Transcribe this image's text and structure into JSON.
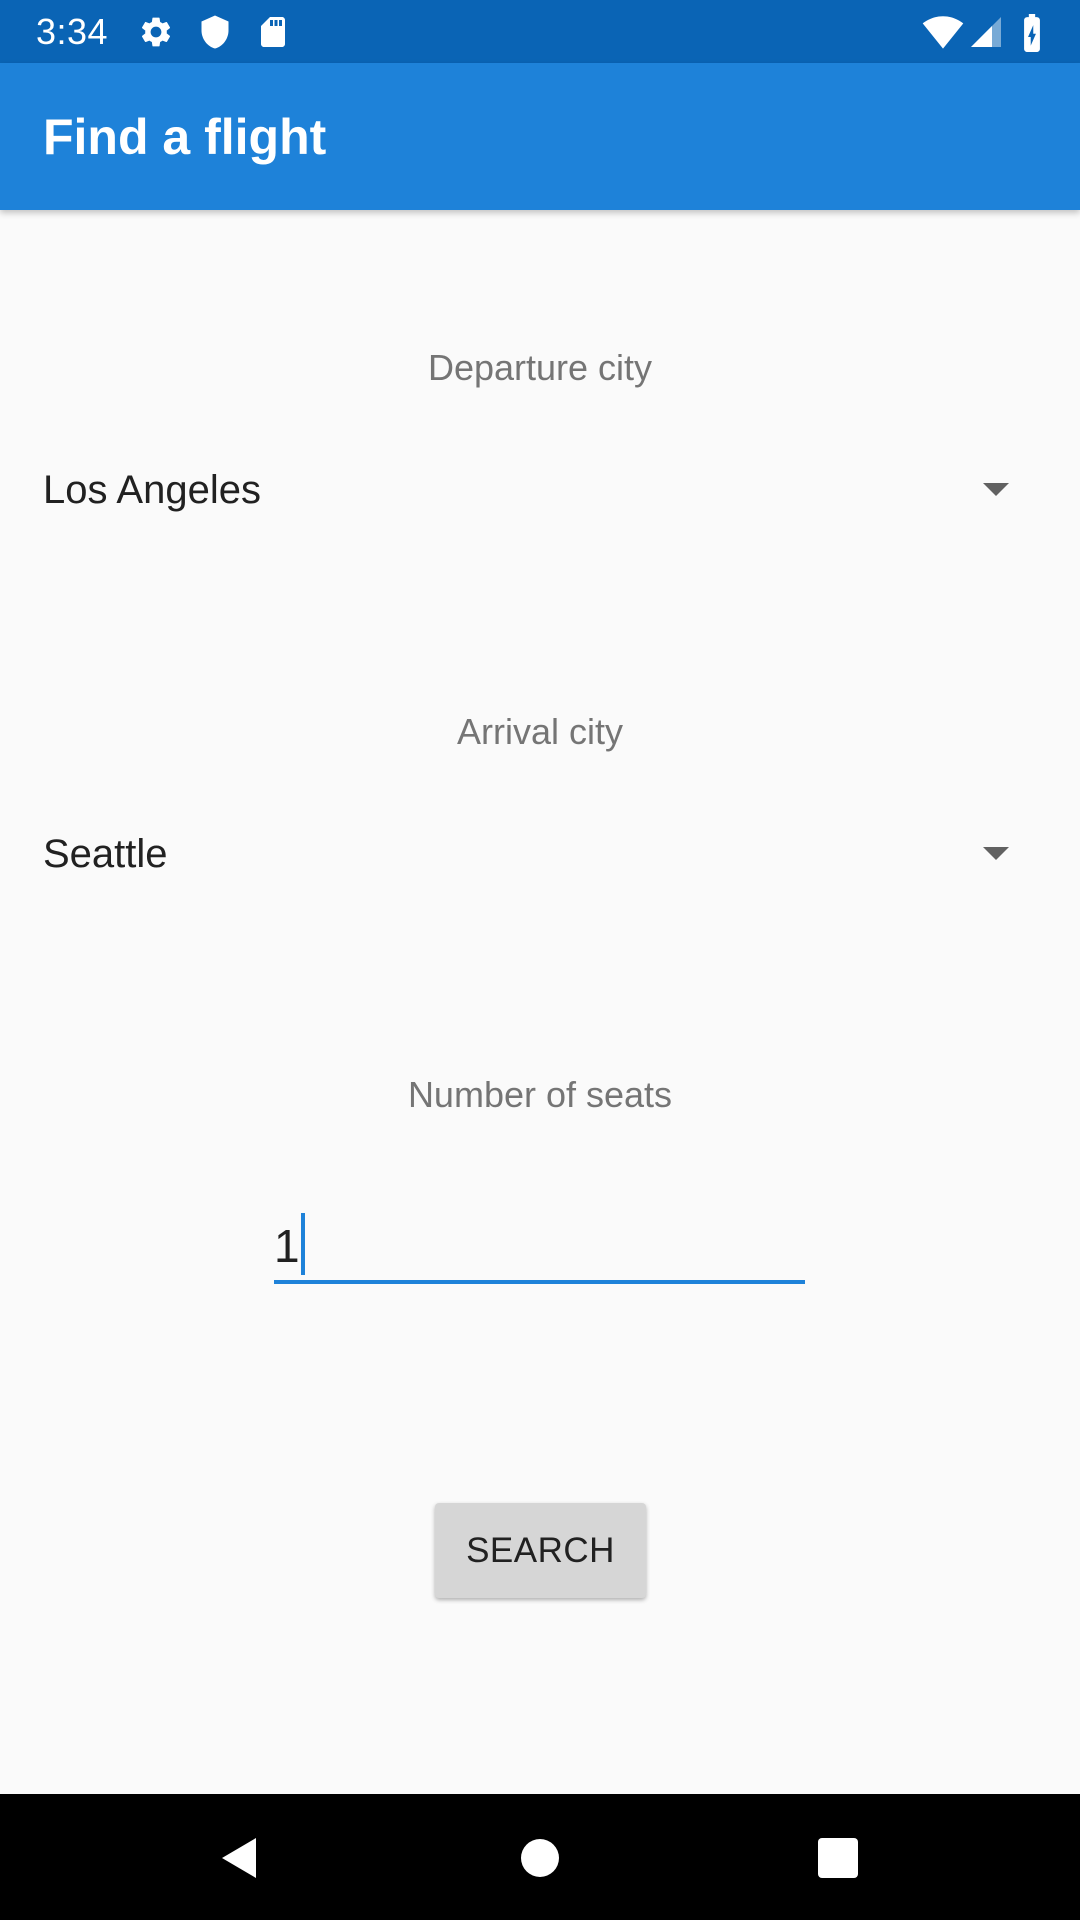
{
  "status_bar": {
    "time": "3:34",
    "background_color": "#0A64B5",
    "icons_left": [
      "gear-icon",
      "shield-icon",
      "sd-card-icon"
    ],
    "icons_right": [
      "wifi-icon",
      "signal-icon",
      "battery-charging-icon"
    ]
  },
  "app_bar": {
    "title": "Find a flight",
    "background_color": "#1E82D9"
  },
  "form": {
    "departure": {
      "label": "Departure city",
      "selected_value": "Los Angeles"
    },
    "arrival": {
      "label": "Arrival city",
      "selected_value": "Seattle"
    },
    "seats": {
      "label": "Number of seats",
      "value": "1",
      "underline_color": "#1E82D9"
    },
    "search_button_label": "SEARCH"
  },
  "nav_bar": {
    "buttons": [
      "back-icon",
      "home-icon",
      "recents-icon"
    ]
  }
}
